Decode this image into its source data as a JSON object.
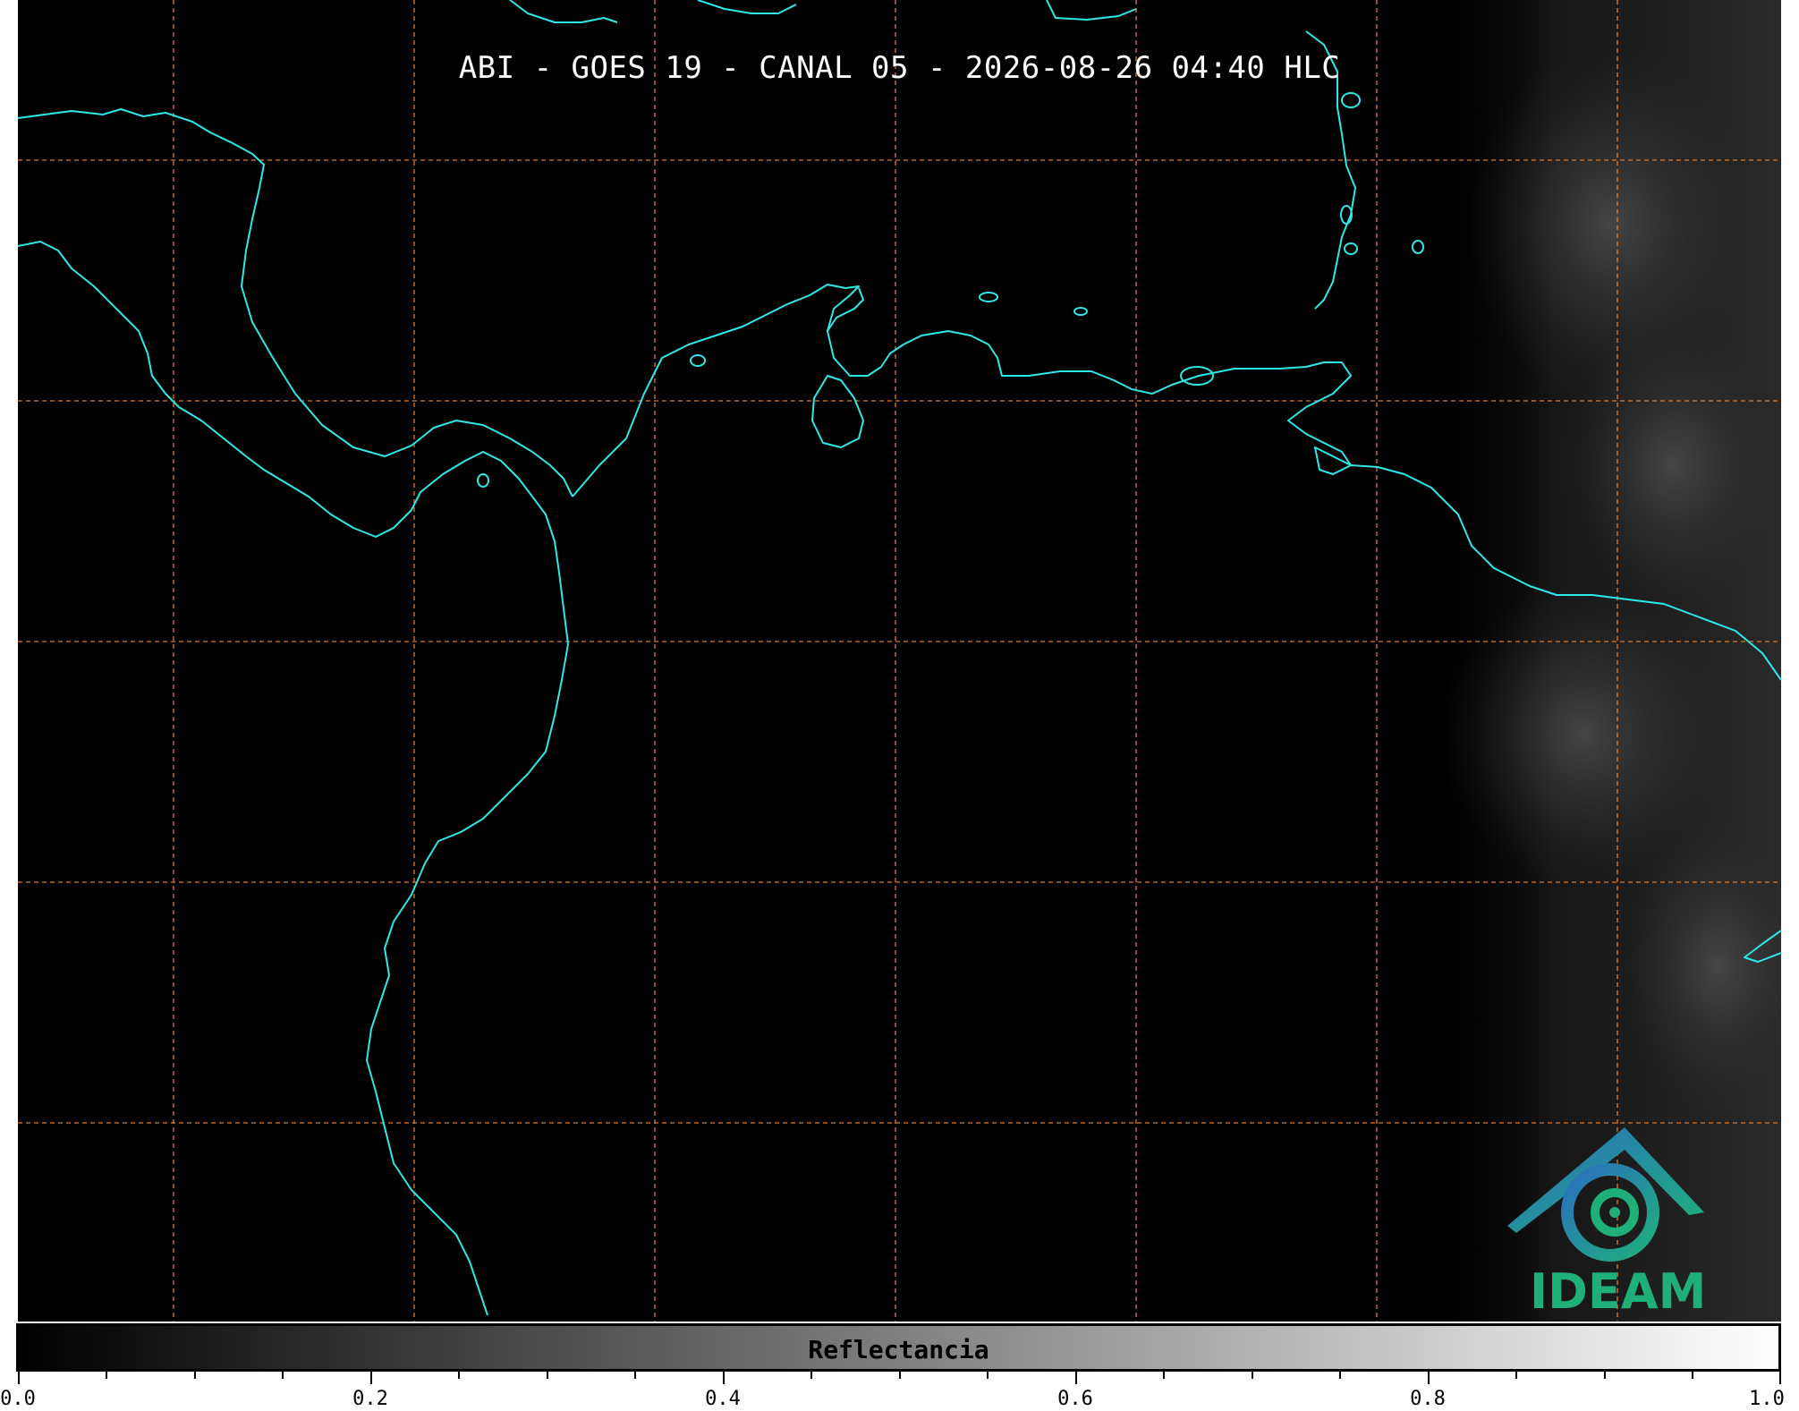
{
  "title": "ABI - GOES 19 - CANAL 05 - 2026-08-26 04:40 HLC",
  "colors": {
    "background": "#000000",
    "coastline": "#2ee8e8",
    "gridline": "#e07a2a",
    "logo_green": "#1fb07a",
    "logo_blue": "#2a7fb8"
  },
  "logo": {
    "text": "IDEAM"
  },
  "colorbar": {
    "label": "Reflectancia",
    "min": 0.0,
    "max": 1.0,
    "tick_labels": [
      "0.0",
      "0.2",
      "0.4",
      "0.6",
      "0.8",
      "1.0"
    ]
  }
}
